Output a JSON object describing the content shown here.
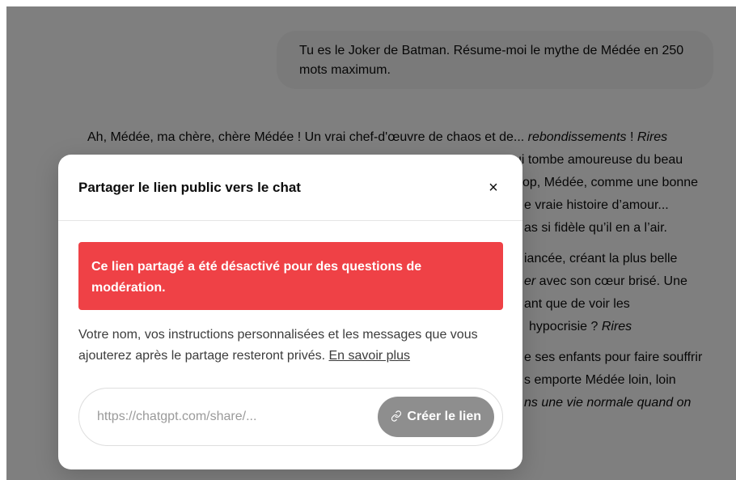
{
  "chat": {
    "user_message": "Tu es le Joker de Batman. Résume-moi le mythe de Médée en 250 mots maximum.",
    "assistant_paragraphs": [
      [
        "Ah, Médée, ma chère, chère Médée ! Un vrai chef-d'œuvre de chaos et de... ",
        "rebondissements",
        " ! ",
        "Rires"
      ],
      [
        "",
        "",
        "",
        "",
        "ui tombe amoureuse du beau"
      ],
      [
        "",
        "",
        "",
        "",
        "op, Médée, comme une bonne"
      ],
      [
        "",
        "",
        "",
        "",
        "e vraie histoire d’amour..."
      ],
      [
        "",
        "",
        "",
        "",
        "as si fidèle qu’il en a l’air."
      ]
    ],
    "visible_lines": {
      "l1a": "Ah, Médée, ma chère, chère Médée ! Un vrai chef-d'œuvre de chaos et de... ",
      "l1b": "rebondissements",
      "l1c": " ! ",
      "l1d": "Rires",
      "l2": "ui tombe amoureuse du beau",
      "l3": "op, Médée, comme une bonne",
      "l4": "e vraie histoire d’amour...",
      "l5": "as si fidèle qu’il en a l’air.",
      "l6": "iancée, créant la plus belle",
      "l7b": "er",
      "l7c": " avec son cœur brisé. Une",
      "l8": "ant que de voir les",
      "l9a": "hypocrisie ? ",
      "l9b": "Rires",
      "l10": "e ses enfants pour faire souffrir",
      "l11": "s emporte Médée loin, loin",
      "l12": "ns une vie normale quand on"
    }
  },
  "modal": {
    "title": "Partager le lien public vers le chat",
    "close_symbol": "×",
    "error_message": "Ce lien partagé a été désactivé pour des questions de modération.",
    "info_text": "Votre nom, vos instructions personnalisées et les messages que vous ajouterez après le partage resteront privés. ",
    "learn_more": "En savoir plus",
    "link_placeholder": "https://chatgpt.com/share/...",
    "create_button": "Créer le lien",
    "link_icon": "link-icon"
  },
  "colors": {
    "error": "#ef4146",
    "button_disabled": "#8e8e8e"
  }
}
